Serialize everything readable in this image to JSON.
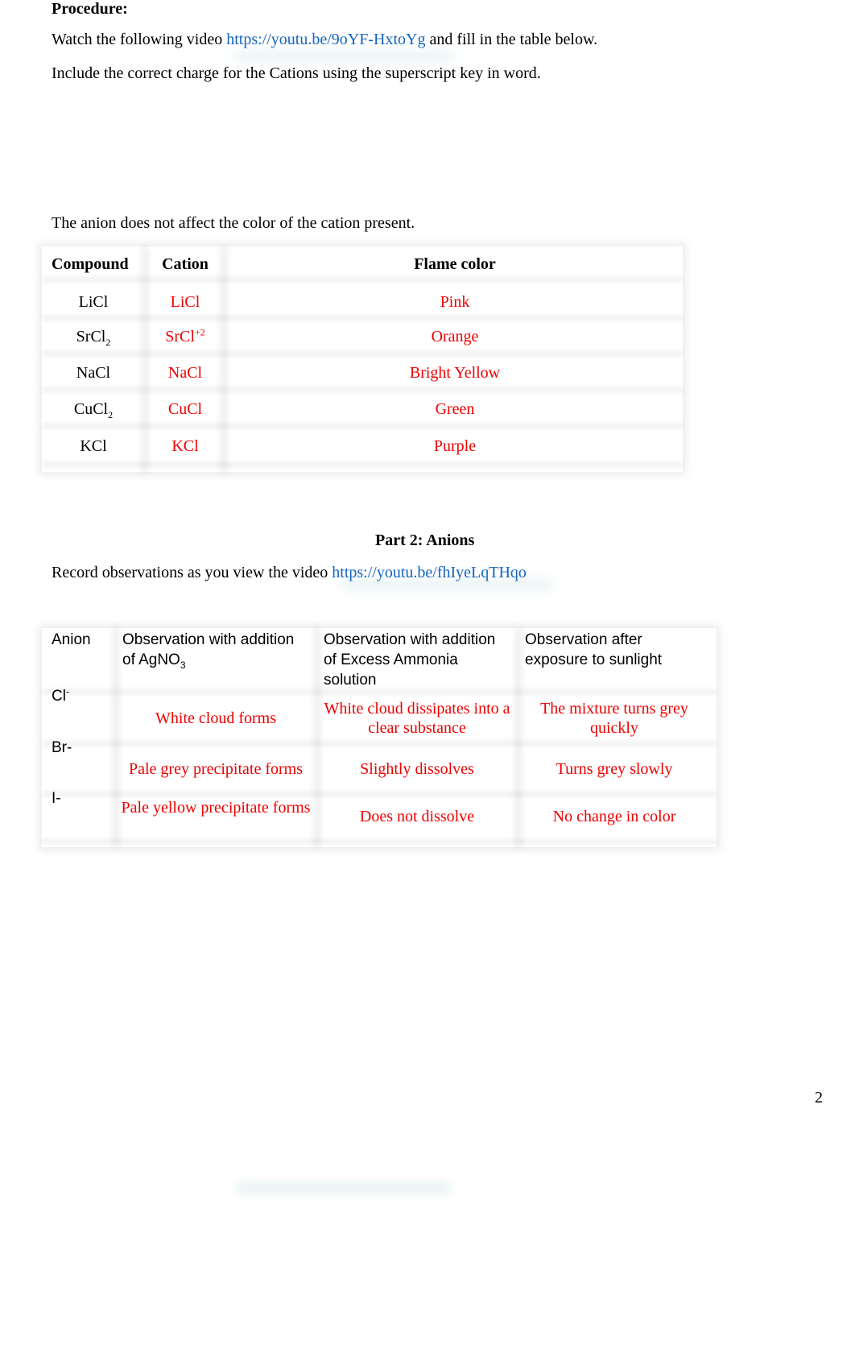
{
  "procedure": {
    "heading": "Procedure:",
    "watch_prefix": "Watch the following video ",
    "watch_link": "https://youtu.be/9oYF-HxtoYg",
    "watch_suffix": "  and fill in the table below.",
    "instruction": "Include the correct charge for the Cations using the superscript key in word."
  },
  "part1": {
    "note": "The anion does not affect the color of the cation present.",
    "table": {
      "headers": [
        "Compound",
        "Cation",
        "Flame color"
      ],
      "rows": [
        {
          "compound": "LiCl",
          "compound_sub": "",
          "cation": "LiCl",
          "cation_sup": "",
          "flame": "Pink"
        },
        {
          "compound": "SrCl",
          "compound_sub": "2",
          "cation": "SrCl",
          "cation_sup": "+2",
          "flame": "Orange"
        },
        {
          "compound": "NaCl",
          "compound_sub": "",
          "cation": "NaCl",
          "cation_sup": "",
          "flame": "Bright Yellow"
        },
        {
          "compound": "CuCl",
          "compound_sub": "2",
          "cation": "CuCl",
          "cation_sup": "",
          "flame": "Green"
        },
        {
          "compound": "KCl",
          "compound_sub": "",
          "cation": "KCl",
          "cation_sup": "",
          "flame": "Purple"
        }
      ]
    }
  },
  "part2": {
    "heading": "Part 2: Anions",
    "record_prefix": "Record observations as you view the video ",
    "record_link": "https://youtu.be/fhIyeLqTHqo",
    "table": {
      "headers": {
        "anion": "Anion",
        "agno3_prefix": "Observation with addition of AgNO",
        "agno3_sub": "3",
        "ammonia": "Observation with addition of Excess Ammonia solution",
        "sunlight": "Observation after exposure to sunlight"
      },
      "rows": [
        {
          "anion": "Cl",
          "anion_sup": "-",
          "agno3": "White cloud forms",
          "ammonia": "White cloud dissipates into a clear substance",
          "sunlight": "The mixture turns grey quickly"
        },
        {
          "anion": "Br-",
          "anion_sup": "",
          "agno3": "Pale grey precipitate forms",
          "ammonia": "Slightly dissolves",
          "sunlight": "Turns grey slowly"
        },
        {
          "anion": "I-",
          "anion_sup": "",
          "agno3": "Pale yellow precipitate forms",
          "ammonia": "Does not dissolve",
          "sunlight": "No change in color"
        }
      ]
    }
  },
  "footer": {
    "page_number": "2"
  },
  "colors": {
    "link": "#1565c0",
    "answer_text": "#ee0000",
    "body_text": "#000000"
  }
}
